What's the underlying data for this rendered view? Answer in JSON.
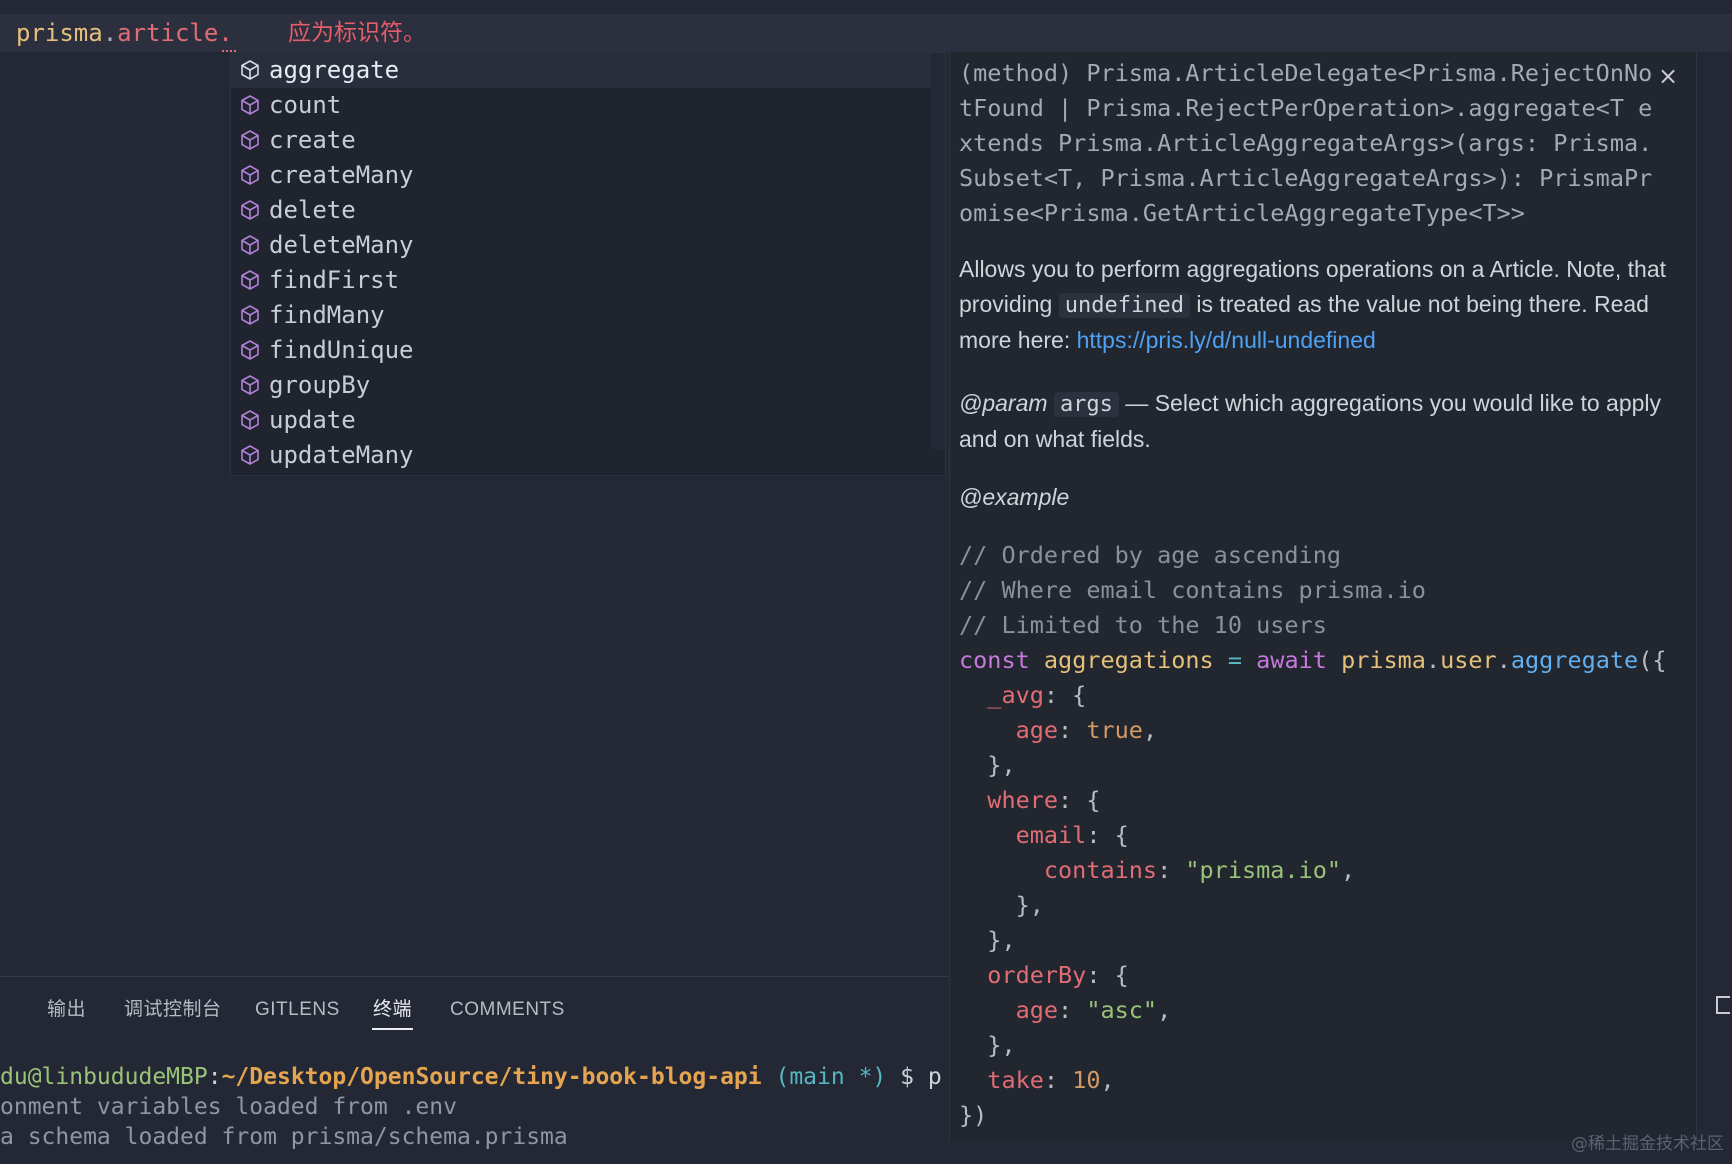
{
  "editor": {
    "ident": "prisma",
    "dot1": ".",
    "prop": "article",
    "dot2": ".",
    "error_message": "应为标识符。"
  },
  "suggestions": {
    "icon": "method-cube-icon",
    "items": [
      {
        "label": "aggregate",
        "selected": true
      },
      {
        "label": "count"
      },
      {
        "label": "create"
      },
      {
        "label": "createMany"
      },
      {
        "label": "delete"
      },
      {
        "label": "deleteMany"
      },
      {
        "label": "findFirst"
      },
      {
        "label": "findMany"
      },
      {
        "label": "findUnique"
      },
      {
        "label": "groupBy"
      },
      {
        "label": "update"
      },
      {
        "label": "updateMany"
      }
    ]
  },
  "details": {
    "signature": "(method) Prisma.ArticleDelegate<Prisma.RejectOnNotFound | Prisma.RejectPerOperation>.aggregate<T extends Prisma.ArticleAggregateArgs>(args: Prisma.Subset<T, Prisma.ArticleAggregateArgs>): PrismaPromise<Prisma.GetArticleAggregateType<T>>",
    "close_label": "×",
    "desc_part1": "Allows you to perform aggregations operations on a Article. Note, that providing ",
    "desc_code": "undefined",
    "desc_part2": " is treated as the value not being there. Read more here: ",
    "desc_link": "https://pris.ly/d/null-undefined",
    "param_tag": "@param",
    "param_name": "args",
    "param_desc": " — Select which aggregations you would like to apply and on what fields.",
    "example_tag": "@example",
    "comments": [
      "// Ordered by age ascending",
      "// Where email contains prisma.io",
      "// Limited to the 10 users"
    ],
    "code": {
      "const": "const",
      "var": "aggregations",
      "eq": "=",
      "await": "await",
      "obj": "prisma",
      "user": "user",
      "fn": "aggregate",
      "avg": "_avg",
      "age": "age",
      "true": "true",
      "where": "where",
      "email": "email",
      "contains": "contains",
      "contains_val": "\"prisma.io\"",
      "orderBy": "orderBy",
      "asc": "\"asc\"",
      "take": "take",
      "ten": "10"
    }
  },
  "panel": {
    "tabs": [
      {
        "label": "输出"
      },
      {
        "label": "调试控制台"
      },
      {
        "label": "GITLENS"
      },
      {
        "label": "终端",
        "active": true
      },
      {
        "label": "COMMENTS"
      }
    ]
  },
  "terminal": {
    "user": "du@linbududeMBP",
    "colon": ":",
    "path": "~/Desktop/OpenSource/tiny-book-blog-api",
    "branch": "(main *)",
    "prompt": "$ p",
    "line2": "onment variables loaded from .env",
    "line3": "a schema loaded from prisma/schema.prisma"
  },
  "watermark": "@稀土掘金技术社区",
  "colors": {
    "background": "#232834",
    "identifier": "#e5c07b",
    "property": "#e06c75",
    "error": "#e35d6a",
    "link": "#4ea1f3",
    "keyword": "#c678dd",
    "string": "#98c379",
    "function": "#61afef"
  }
}
